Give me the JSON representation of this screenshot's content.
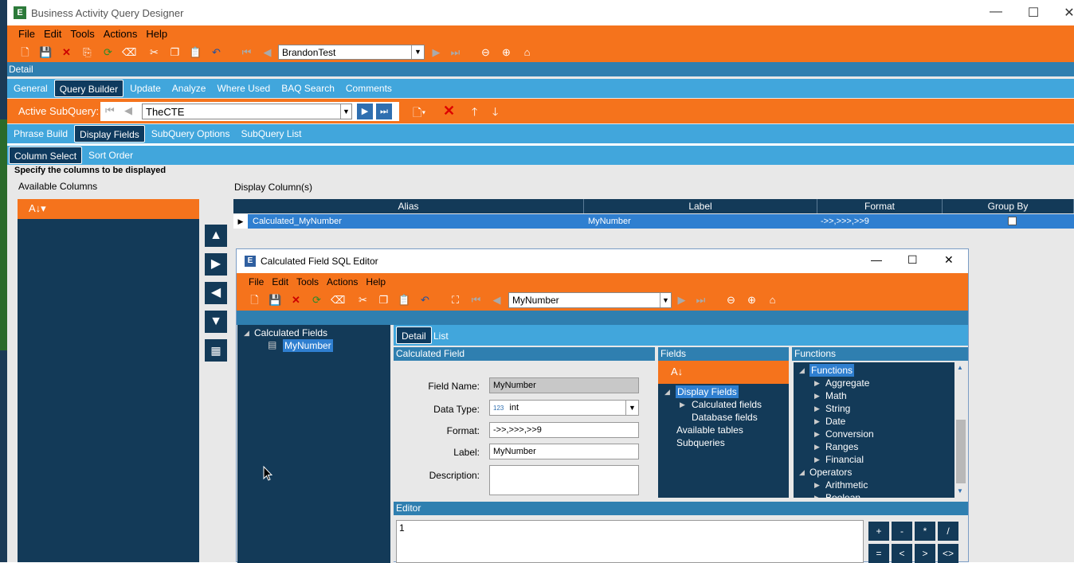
{
  "app": {
    "title": "Business Activity Query Designer",
    "menu": [
      "File",
      "Edit",
      "Tools",
      "Actions",
      "Help"
    ],
    "record_value": "BrandonTest",
    "detail_label": "Detail",
    "tabs": [
      "General",
      "Query Builder",
      "Update",
      "Analyze",
      "Where Used",
      "BAQ Search",
      "Comments"
    ],
    "active_subquery_label": "Active SubQuery:",
    "subquery_value": "TheCTE",
    "subtabs": [
      "Phrase Build",
      "Display Fields",
      "SubQuery Options",
      "SubQuery List"
    ],
    "subsubtabs": [
      "Column Select",
      "Sort Order"
    ],
    "instruction": "Specify the columns to be displayed",
    "available_columns_label": "Available Columns",
    "display_columns_label": "Display Column(s)",
    "grid": {
      "headers": [
        "Alias",
        "Label",
        "Format",
        "Group By"
      ],
      "rows": [
        {
          "alias": "Calculated_MyNumber",
          "label": "MyNumber",
          "format": "->>,>>>,>>9"
        }
      ]
    }
  },
  "dialog": {
    "title": "Calculated Field SQL Editor",
    "menu": [
      "File",
      "Edit",
      "Tools",
      "Actions",
      "Help"
    ],
    "record_value": "MyNumber",
    "tree_root": "Calculated Fields",
    "tree_child": "MyNumber",
    "tabs": [
      "Detail",
      "List"
    ],
    "section_calc": "Calculated Field",
    "section_fields": "Fields",
    "section_functions": "Functions",
    "section_editor": "Editor",
    "labels": {
      "field_name": "Field Name:",
      "data_type": "Data Type:",
      "format": "Format:",
      "label": "Label:",
      "description": "Description:"
    },
    "values": {
      "field_name": "MyNumber",
      "data_type_badge": "123",
      "data_type": "int",
      "format": "->>,>>>,>>9",
      "label": "MyNumber"
    },
    "fields_tree": [
      "Display Fields",
      "Calculated fields",
      "Database fields",
      "Available tables",
      "Subqueries"
    ],
    "functions_tree": [
      "Functions",
      "Aggregate",
      "Math",
      "String",
      "Date",
      "Conversion",
      "Ranges",
      "Financial",
      "Operators",
      "Arithmetic",
      "Boolean"
    ],
    "editor_text": "1",
    "operators": [
      "+",
      "-",
      "*",
      "/",
      "=",
      "<",
      ">",
      "<>"
    ]
  }
}
